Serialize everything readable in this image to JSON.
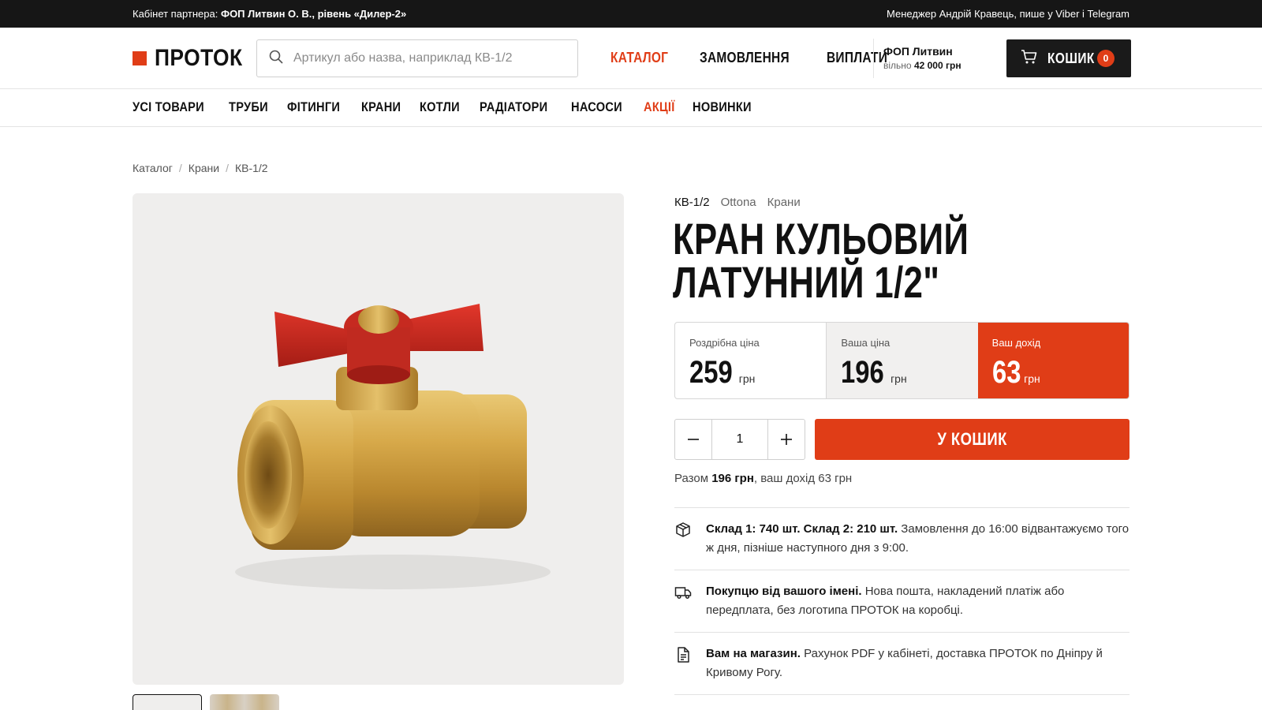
{
  "topbar": {
    "partner_prefix": "Кабінет партнера:",
    "partner_name": "ФОП Литвин О. В., рівень «Дилер-2»",
    "manager": "Менеджер Андрій Кравець, пише у Viber і Telegram"
  },
  "header": {
    "logo": "ПРОТОК",
    "search_placeholder": "Артикул або назва, наприклад КВ-1/2",
    "nav": [
      "КАТАЛОГ",
      "ЗАМОВЛЕННЯ",
      "ВИПЛАТИ"
    ],
    "active_nav": "КАТАЛОГ",
    "account_name": "ФОП Литвин",
    "balance_label": "вільно",
    "balance_value": "42 000 грн",
    "cart_label": "КОШИК",
    "cart_count": "0"
  },
  "categories": [
    "УСІ ТОВАРИ",
    "ТРУБИ",
    "ФІТИНГИ",
    "КРАНИ",
    "КОТЛИ",
    "РАДІАТОРИ",
    "НАСОСИ",
    "АКЦІЇ",
    "НОВИНКИ"
  ],
  "breadcrumb": [
    "Каталог",
    "Крани",
    "КВ-1/2"
  ],
  "product": {
    "sku": "КВ-1/2",
    "brand": "Ottona",
    "category": "Крани",
    "title_line1": "КРАН КУЛЬОВИЙ",
    "title_line2": "ЛАТУННИЙ 1/2\"",
    "retail_label": "Роздрібна ціна",
    "retail_price": "259",
    "your_label": "Ваша ціна",
    "your_price": "196",
    "income_label": "Ваш дохід",
    "income": "63",
    "currency": "грн",
    "quantity": "1",
    "add_to_cart": "У КОШИК",
    "total_prefix": "Разом",
    "total_value": "196 грн",
    "total_suffix": ", ваш дохід 63 грн"
  },
  "info": [
    {
      "icon": "box-icon",
      "bold": "Склад 1: 740 шт. Склад 2: 210 шт.",
      "text": " Замовлення до 16:00 відвантажуємо того ж дня, пізніше наступного дня з 9:00."
    },
    {
      "icon": "truck-icon",
      "bold": "Покупцю від вашого імені.",
      "text": " Нова пошта, накладений платіж або передплата, без логотипа ПРОТОК на коробці."
    },
    {
      "icon": "document-icon",
      "bold": "Вам на магазин.",
      "text": " Рахунок PDF у кабінеті, доставка ПРОТОК по Дніпру й Кривому Рогу."
    }
  ],
  "colors": {
    "accent": "#e03d17",
    "dark": "#161616"
  }
}
